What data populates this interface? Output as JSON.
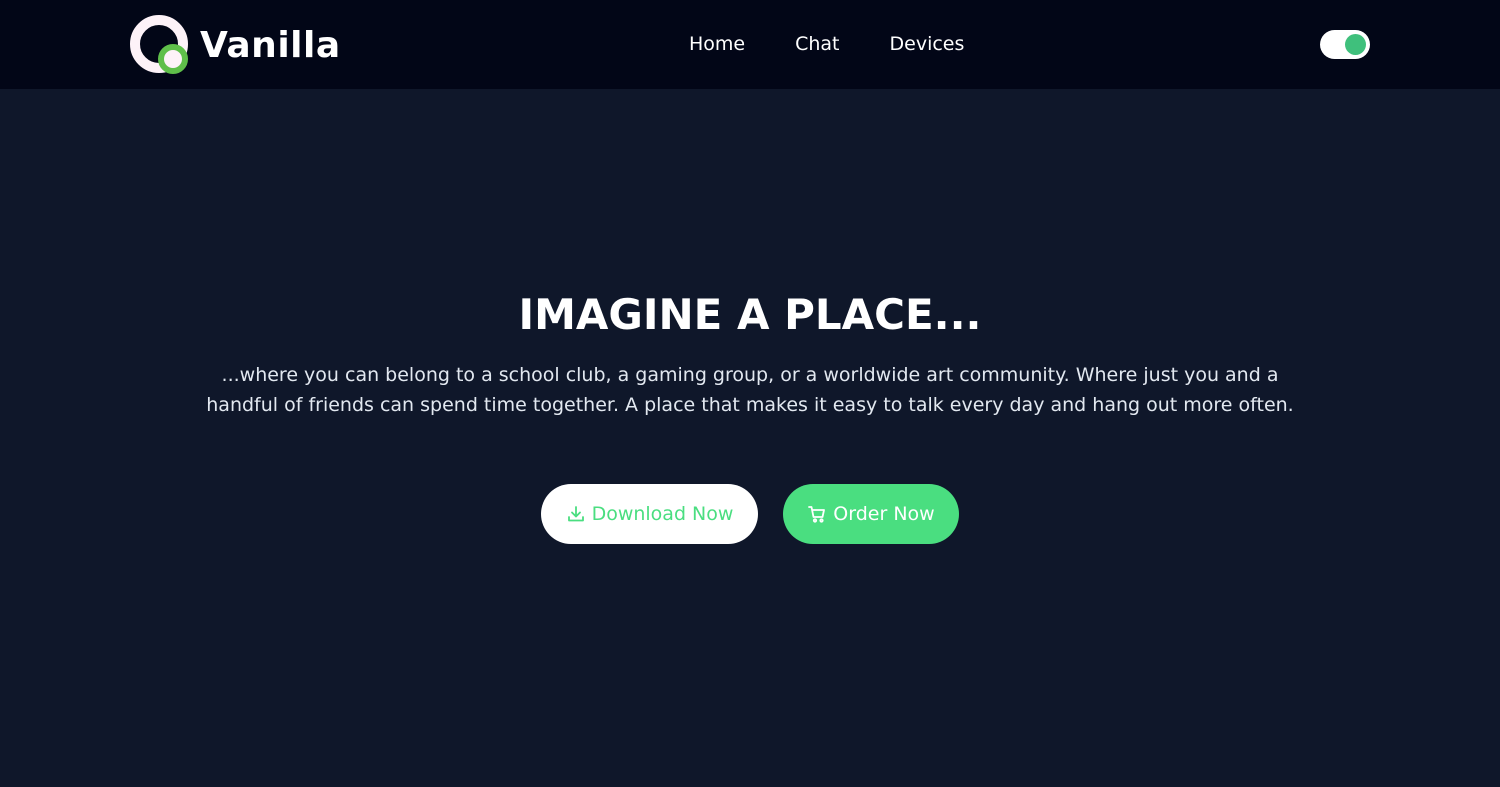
{
  "header": {
    "brand": "Vanilla",
    "nav": [
      {
        "label": "Home"
      },
      {
        "label": "Chat"
      },
      {
        "label": "Devices"
      }
    ],
    "theme_toggle": {
      "state": "on"
    }
  },
  "hero": {
    "title": "IMAGINE A PLACE...",
    "description": "...where you can belong to a school club, a gaming group, or a worldwide art community. Where just you and a handful of friends can spend time together. A place that makes it easy to talk every day and hang out more often.",
    "buttons": {
      "download": {
        "label": "Download Now",
        "icon": "download-icon"
      },
      "order": {
        "label": "Order Now",
        "icon": "cart-icon"
      }
    }
  },
  "colors": {
    "header_bg": "#020617",
    "page_bg": "#0f172a",
    "accent": "#4ade80",
    "toggle_knob": "#3fc07c",
    "logo_ring": "#5fbf4a"
  }
}
